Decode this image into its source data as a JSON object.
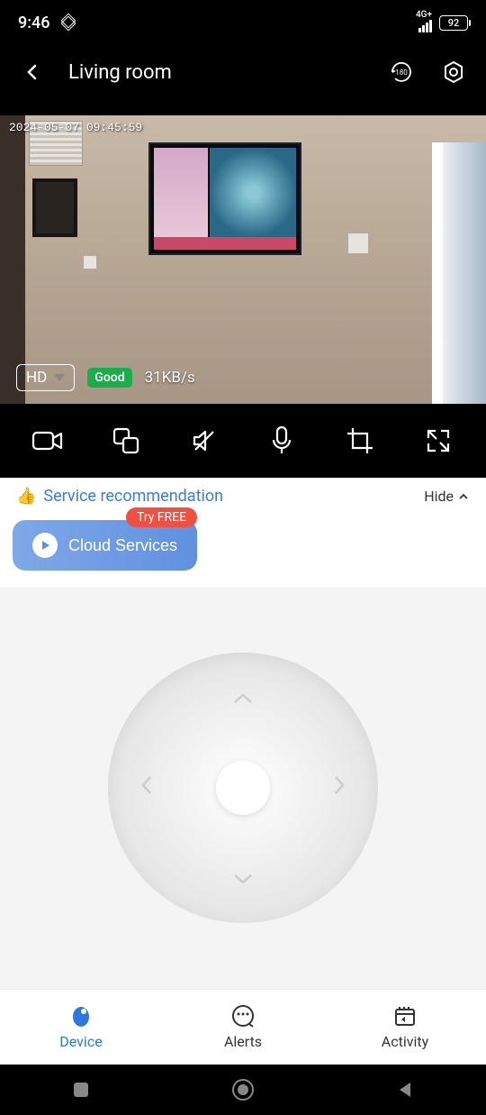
{
  "status": {
    "time": "9:46",
    "network": "4G+",
    "battery": "92"
  },
  "header": {
    "title": "Living room"
  },
  "video": {
    "timestamp": "2024-05-07 09:45:59",
    "quality": "HD",
    "connection": "Good",
    "bitrate": "31KB/s"
  },
  "reco": {
    "label": "Service recommendation",
    "hide": "Hide",
    "try_badge": "Try FREE",
    "cloud_btn": "Cloud Services"
  },
  "nav": {
    "device": "Device",
    "alerts": "Alerts",
    "activity": "Activity"
  }
}
